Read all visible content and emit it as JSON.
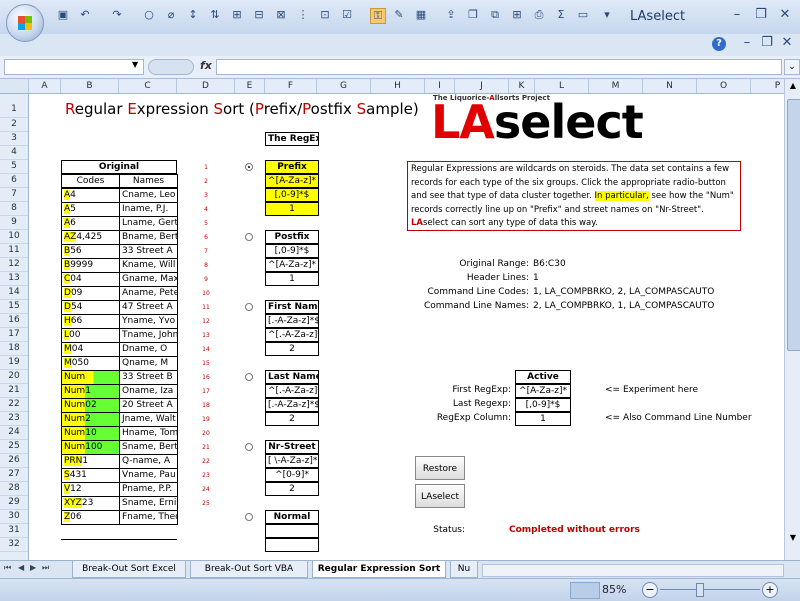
{
  "window": {
    "app_name": "LAselect"
  },
  "formula_bar": {
    "fx_label": "fx",
    "name_box": "",
    "formula": ""
  },
  "columns": [
    "A",
    "B",
    "C",
    "D",
    "E",
    "F",
    "G",
    "H",
    "I",
    "J",
    "K",
    "L",
    "M",
    "N",
    "O",
    "P"
  ],
  "rows": [
    "1",
    "2",
    "3",
    "4",
    "5",
    "6",
    "7",
    "8",
    "9",
    "10",
    "11",
    "12",
    "13",
    "14",
    "15",
    "16",
    "17",
    "18",
    "19",
    "20",
    "21",
    "22",
    "23",
    "24",
    "25",
    "26",
    "27",
    "28",
    "29",
    "30",
    "31",
    "32"
  ],
  "sheet": {
    "title_parts": [
      {
        "text": "R",
        "color": "#c00000"
      },
      {
        "text": "egular ",
        "color": "#000000"
      },
      {
        "text": "E",
        "color": "#c00000"
      },
      {
        "text": "xpression ",
        "color": "#000000"
      },
      {
        "text": "S",
        "color": "#c00000"
      },
      {
        "text": "ort (",
        "color": "#000000"
      },
      {
        "text": "P",
        "color": "#c00000"
      },
      {
        "text": "refix/",
        "color": "#000000"
      },
      {
        "text": "P",
        "color": "#c00000"
      },
      {
        "text": "ostfix ",
        "color": "#000000"
      },
      {
        "text": "S",
        "color": "#c00000"
      },
      {
        "text": "ample)",
        "color": "#000000"
      }
    ],
    "project_label": {
      "pre": "The ",
      "l": "L",
      "mid1": "iquorice-",
      "a": "A",
      "post": "llsorts Project"
    },
    "logo": {
      "la": "LA",
      "select": "select"
    },
    "original_header": "Original",
    "codes_header": "Codes",
    "names_header": "Names",
    "codes": [
      "A4",
      "A5",
      "A6",
      "AZ4,425",
      "B56",
      "B9999",
      "C04",
      "D09",
      "D54",
      "H66",
      "L00",
      "M04",
      "M050",
      "Num",
      "Num1",
      "Num02",
      "Num2",
      "Num10",
      "Num100",
      "PRN1",
      "S431",
      "V12",
      "XYZ23",
      "Z06"
    ],
    "names": [
      "Cname, Leo",
      "Iname, P.J.",
      "Lname, Gert",
      "Bname, Bert",
      "33 Street A",
      "Kname, Will",
      "Gname, Max",
      "Aname, Pete",
      "47 Street A",
      "Yname, Yvo",
      "Tname, John",
      "Dname, O",
      "Qname, M",
      "33 Street B",
      "Oname, Iza",
      "20 Street A",
      "Jname, Walt",
      "Hname, Tom",
      "Sname, Bert",
      "Q-name, A",
      "Vname, Pau",
      "Pname, P.P.",
      "Sname, Ernie",
      "Fname, Theo"
    ],
    "row_numbers": [
      "1",
      "2",
      "3",
      "4",
      "5",
      "6",
      "7",
      "8",
      "9",
      "10",
      "11",
      "12",
      "13",
      "14",
      "15",
      "16",
      "17",
      "18",
      "19",
      "20",
      "21",
      "22",
      "23",
      "24",
      "25"
    ],
    "regex_header": "The RegEx",
    "groups": [
      {
        "name": "Prefix",
        "first": "^[A-Za-z]*",
        "last": "[,0-9]*$",
        "col": "1"
      },
      {
        "name": "Postfix",
        "first": "[,0-9]*$",
        "last": "^[A-Za-z]*",
        "col": "1"
      },
      {
        "name": "First Name",
        "first": "[.-A-Za-z]*$",
        "last": "^[.-A-Za-z]*",
        "col": "2"
      },
      {
        "name": "Last Name",
        "first": "^[.-A-Za-z]*",
        "last": "[.-A-Za-z]*$",
        "col": "2"
      },
      {
        "name": "Nr-Street",
        "first": "[ \\-A-Za-z]*$",
        "last": "^[0-9]*",
        "col": "2"
      },
      {
        "name": "Normal",
        "first": "",
        "last": "",
        "col": ""
      }
    ],
    "description": [
      {
        "text": "Regular Expressions are wildcards on steroids. The data set contains a few records for each type of the six groups. Click the appropriate radio-button and see that type of data cluster together. ",
        "hl": false
      },
      {
        "text": "In particular,",
        "hl": true
      },
      {
        "text": " see how  the \"Num\" records correctly line up on \"Prefix\" and street names on \"Nr-Street\". ",
        "hl": false
      },
      {
        "text": "LA",
        "hl": false,
        "red": true
      },
      {
        "text": "select can sort any type of data this way.",
        "hl": false
      }
    ],
    "info": [
      {
        "label": "Original Range:",
        "value": "B6:C30"
      },
      {
        "label": "Header Lines:",
        "value": "1"
      },
      {
        "label": "Command Line Codes:",
        "value": "1, LA_COMPBRKO, 2, LA_COMPASCAUTO"
      },
      {
        "label": "Command Line Names:",
        "value": "2, LA_COMPBRKO, 1, LA_COMPASCAUTO"
      }
    ],
    "active_header": "Active",
    "active": [
      {
        "label": "First RegExp:",
        "value": "^[A-Za-z]*"
      },
      {
        "label": "Last Regexp:",
        "value": "[,0-9]*$"
      },
      {
        "label": "RegExp Column:",
        "value": "1"
      }
    ],
    "note_experiment": "<= Experiment here",
    "note_command": "<= Also Command Line Number",
    "restore_button": "Restore",
    "laselect_button": "LAselect",
    "status_label": "Status:",
    "status_value": "Completed without errors"
  },
  "tabs": [
    "Break-Out Sort Excel",
    "Break-Out Sort VBA",
    "Regular Expression Sort",
    "Nu"
  ],
  "status_bar": {
    "zoom": "85%"
  }
}
